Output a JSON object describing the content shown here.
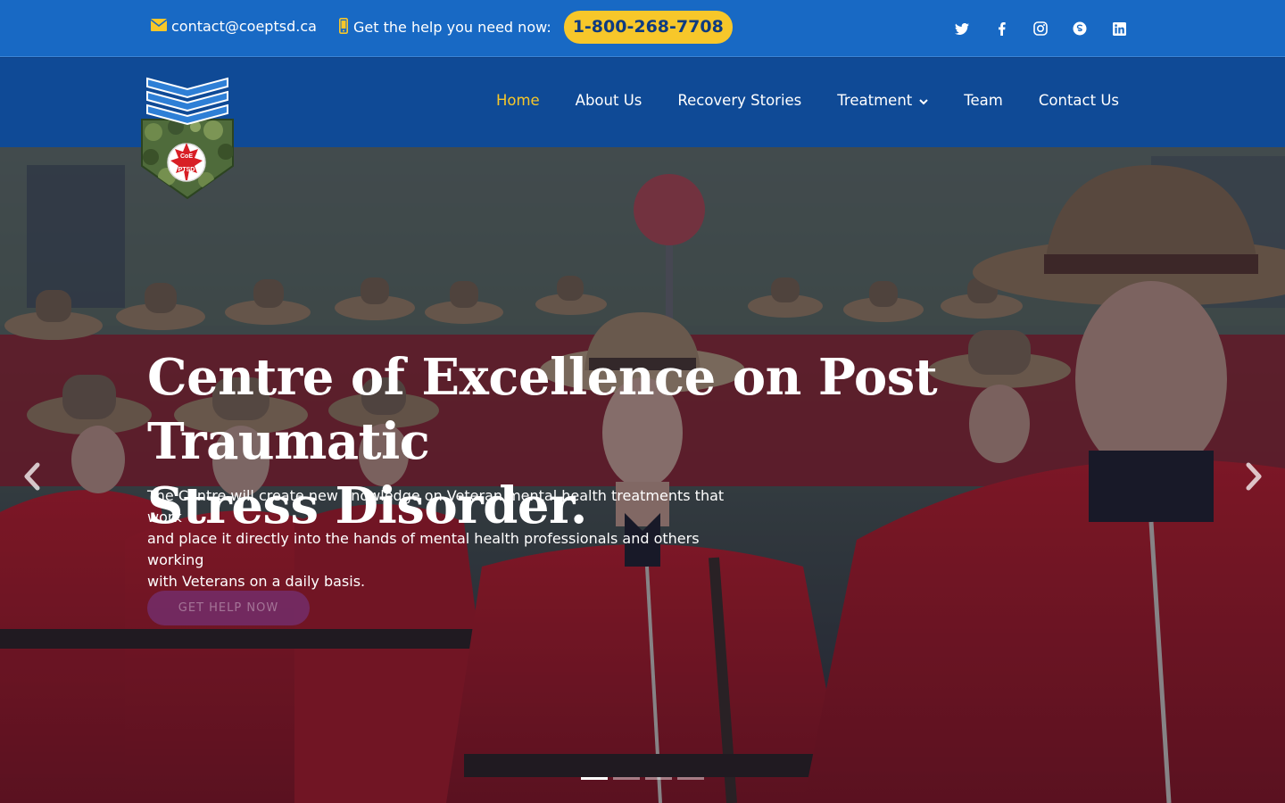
{
  "topbar": {
    "email": "contact@coeptsd.ca",
    "help_text": "Get the help you need now:",
    "phone": "1-800-268-7708",
    "social": [
      "twitter-icon",
      "facebook-icon",
      "instagram-icon",
      "skype-icon",
      "linkedin-icon"
    ]
  },
  "logo": {
    "line1": "CoE",
    "line2": "PTSD"
  },
  "nav": {
    "items": [
      {
        "label": "Home",
        "active": true
      },
      {
        "label": "About Us"
      },
      {
        "label": "Recovery Stories"
      },
      {
        "label": "Treatment",
        "has_dropdown": true
      },
      {
        "label": "Team"
      },
      {
        "label": "Contact Us"
      }
    ]
  },
  "hero": {
    "title_line1": "Centre of Excellence on Post Traumatic",
    "title_line2": "Stress Disorder.",
    "text_line1": "The Centre will create new knowledge on Veteran mental health treatments that work",
    "text_line2": "and place it directly into the hands of mental health professionals and others working",
    "text_line3": "with Veterans on a daily basis.",
    "button": "GET HELP NOW",
    "slides": 4,
    "active_slide": 1
  },
  "colors": {
    "topbar": "#1869c4",
    "nav": "#0f4a96",
    "accent": "#f7c72a",
    "uniform_red": "#c4161c"
  }
}
